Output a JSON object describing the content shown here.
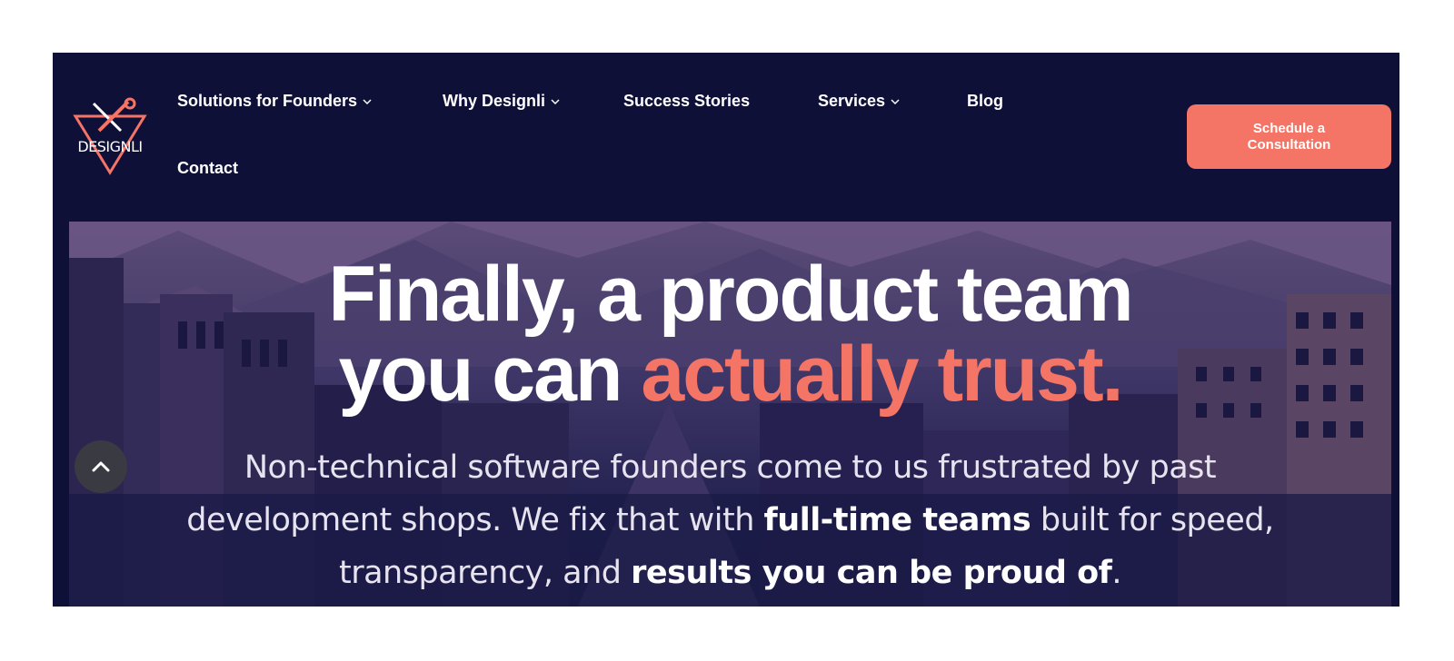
{
  "brand": {
    "logo_text": "DESIGNLI",
    "accent_color": "#f47466",
    "navy_color": "#0f1038"
  },
  "nav": {
    "items": [
      {
        "label": "Solutions for Founders",
        "has_dropdown": true
      },
      {
        "label": "Why Designli",
        "has_dropdown": true
      },
      {
        "label": "Success Stories",
        "has_dropdown": false
      },
      {
        "label": "Services",
        "has_dropdown": true
      },
      {
        "label": "Blog",
        "has_dropdown": false
      },
      {
        "label": "Contact",
        "has_dropdown": false
      }
    ],
    "cta_label": "Schedule a Consultation"
  },
  "hero": {
    "title_line1": "Finally, a product team",
    "title_line2_prefix": "you can",
    "title_line2_accent": "actually trust.",
    "sub_part1": "Non-technical software founders come to us frustrated by past development shops. We fix that with",
    "sub_bold1": "full-time teams",
    "sub_part2": "built for speed, transparency, and",
    "sub_bold2": "results you can be proud of",
    "sub_end": "."
  },
  "icons": {
    "scroll_top": "chevron-up-icon",
    "dropdown": "chevron-down-icon",
    "logo": "wrench-screwdriver-icon"
  }
}
